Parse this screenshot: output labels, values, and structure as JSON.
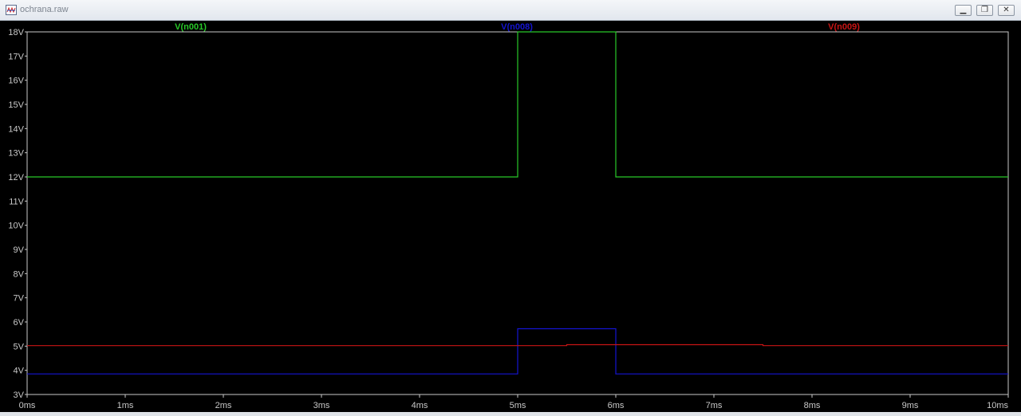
{
  "window": {
    "title": "ochrana.raw",
    "icon": "waveform-icon",
    "buttons": {
      "minimize": "minimize-icon",
      "restore": "restore-icon",
      "close": "close-icon"
    }
  },
  "chart_data": {
    "type": "line",
    "x_unit": "ms",
    "y_unit": "V",
    "xlim": [
      0,
      10
    ],
    "ylim": [
      3,
      18
    ],
    "x_ticks": [
      0,
      1,
      2,
      3,
      4,
      5,
      6,
      7,
      8,
      9,
      10
    ],
    "y_ticks": [
      3,
      4,
      5,
      6,
      7,
      8,
      9,
      10,
      11,
      12,
      13,
      14,
      15,
      16,
      17,
      18
    ],
    "x_tick_labels": [
      "0ms",
      "1ms",
      "2ms",
      "3ms",
      "4ms",
      "5ms",
      "6ms",
      "7ms",
      "8ms",
      "9ms",
      "10ms"
    ],
    "y_tick_labels": [
      "3V",
      "4V",
      "5V",
      "6V",
      "7V",
      "8V",
      "9V",
      "10V",
      "11V",
      "12V",
      "13V",
      "14V",
      "15V",
      "16V",
      "17V",
      "18V"
    ],
    "grid": false,
    "legend": "top, inline above plot",
    "series": [
      {
        "name": "V(n001)",
        "color": "#28c828",
        "x": [
          0,
          5.0,
          5.0,
          6.0,
          6.0,
          10
        ],
        "y": [
          12.0,
          12.0,
          18.0,
          18.0,
          12.0,
          12.0
        ]
      },
      {
        "name": "V(n008)",
        "color": "#1414d2",
        "x": [
          0,
          5.0,
          5.0,
          6.0,
          6.0,
          10
        ],
        "y": [
          3.85,
          3.85,
          5.72,
          5.72,
          3.85,
          3.85
        ]
      },
      {
        "name": "V(n009)",
        "color": "#c81414",
        "x": [
          0,
          5.5,
          5.5,
          7.5,
          7.5,
          10
        ],
        "y": [
          5.02,
          5.02,
          5.06,
          5.06,
          5.02,
          5.02
        ]
      }
    ]
  }
}
